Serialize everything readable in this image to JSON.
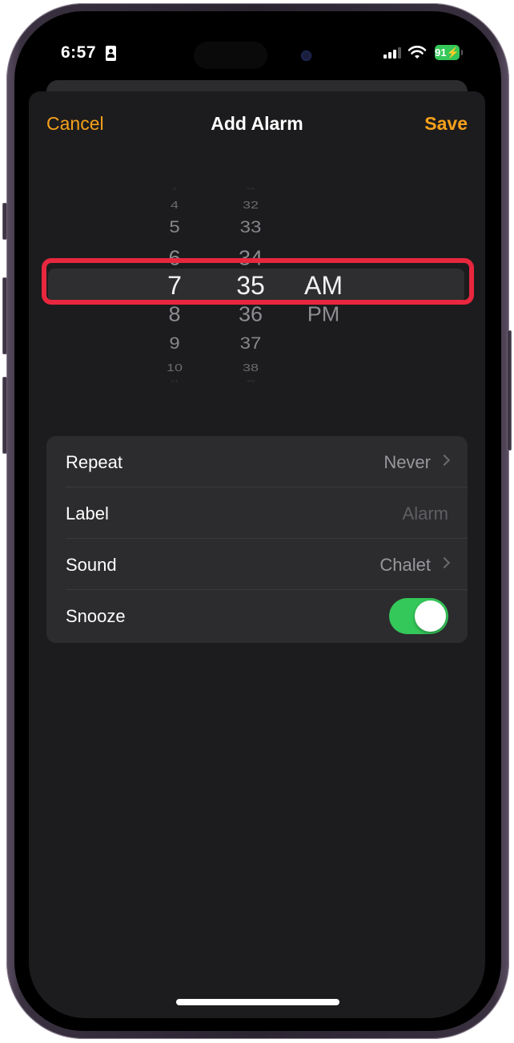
{
  "status_bar": {
    "time": "6:57",
    "battery_percent": "91",
    "battery_charging": true,
    "colors": {
      "battery": "#34c759"
    }
  },
  "nav": {
    "cancel_label": "Cancel",
    "title": "Add Alarm",
    "save_label": "Save",
    "accent_color": "#f6a11b"
  },
  "picker": {
    "hours": [
      "3",
      "4",
      "5",
      "6",
      "7",
      "8",
      "9",
      "10",
      "11"
    ],
    "minutes": [
      "31",
      "32",
      "33",
      "34",
      "35",
      "36",
      "37",
      "38",
      "39"
    ],
    "periods": [
      "AM",
      "PM"
    ],
    "selected": {
      "hour": "7",
      "minute": "35",
      "period": "AM"
    },
    "highlight_color": "#e8273f"
  },
  "settings": {
    "rows": [
      {
        "label": "Repeat",
        "value": "Never",
        "type": "disclosure"
      },
      {
        "label": "Label",
        "value": "Alarm",
        "type": "text-field-placeholder"
      },
      {
        "label": "Sound",
        "value": "Chalet",
        "type": "disclosure"
      },
      {
        "label": "Snooze",
        "value": "on",
        "type": "toggle"
      }
    ],
    "toggle_color": "#34c759"
  }
}
